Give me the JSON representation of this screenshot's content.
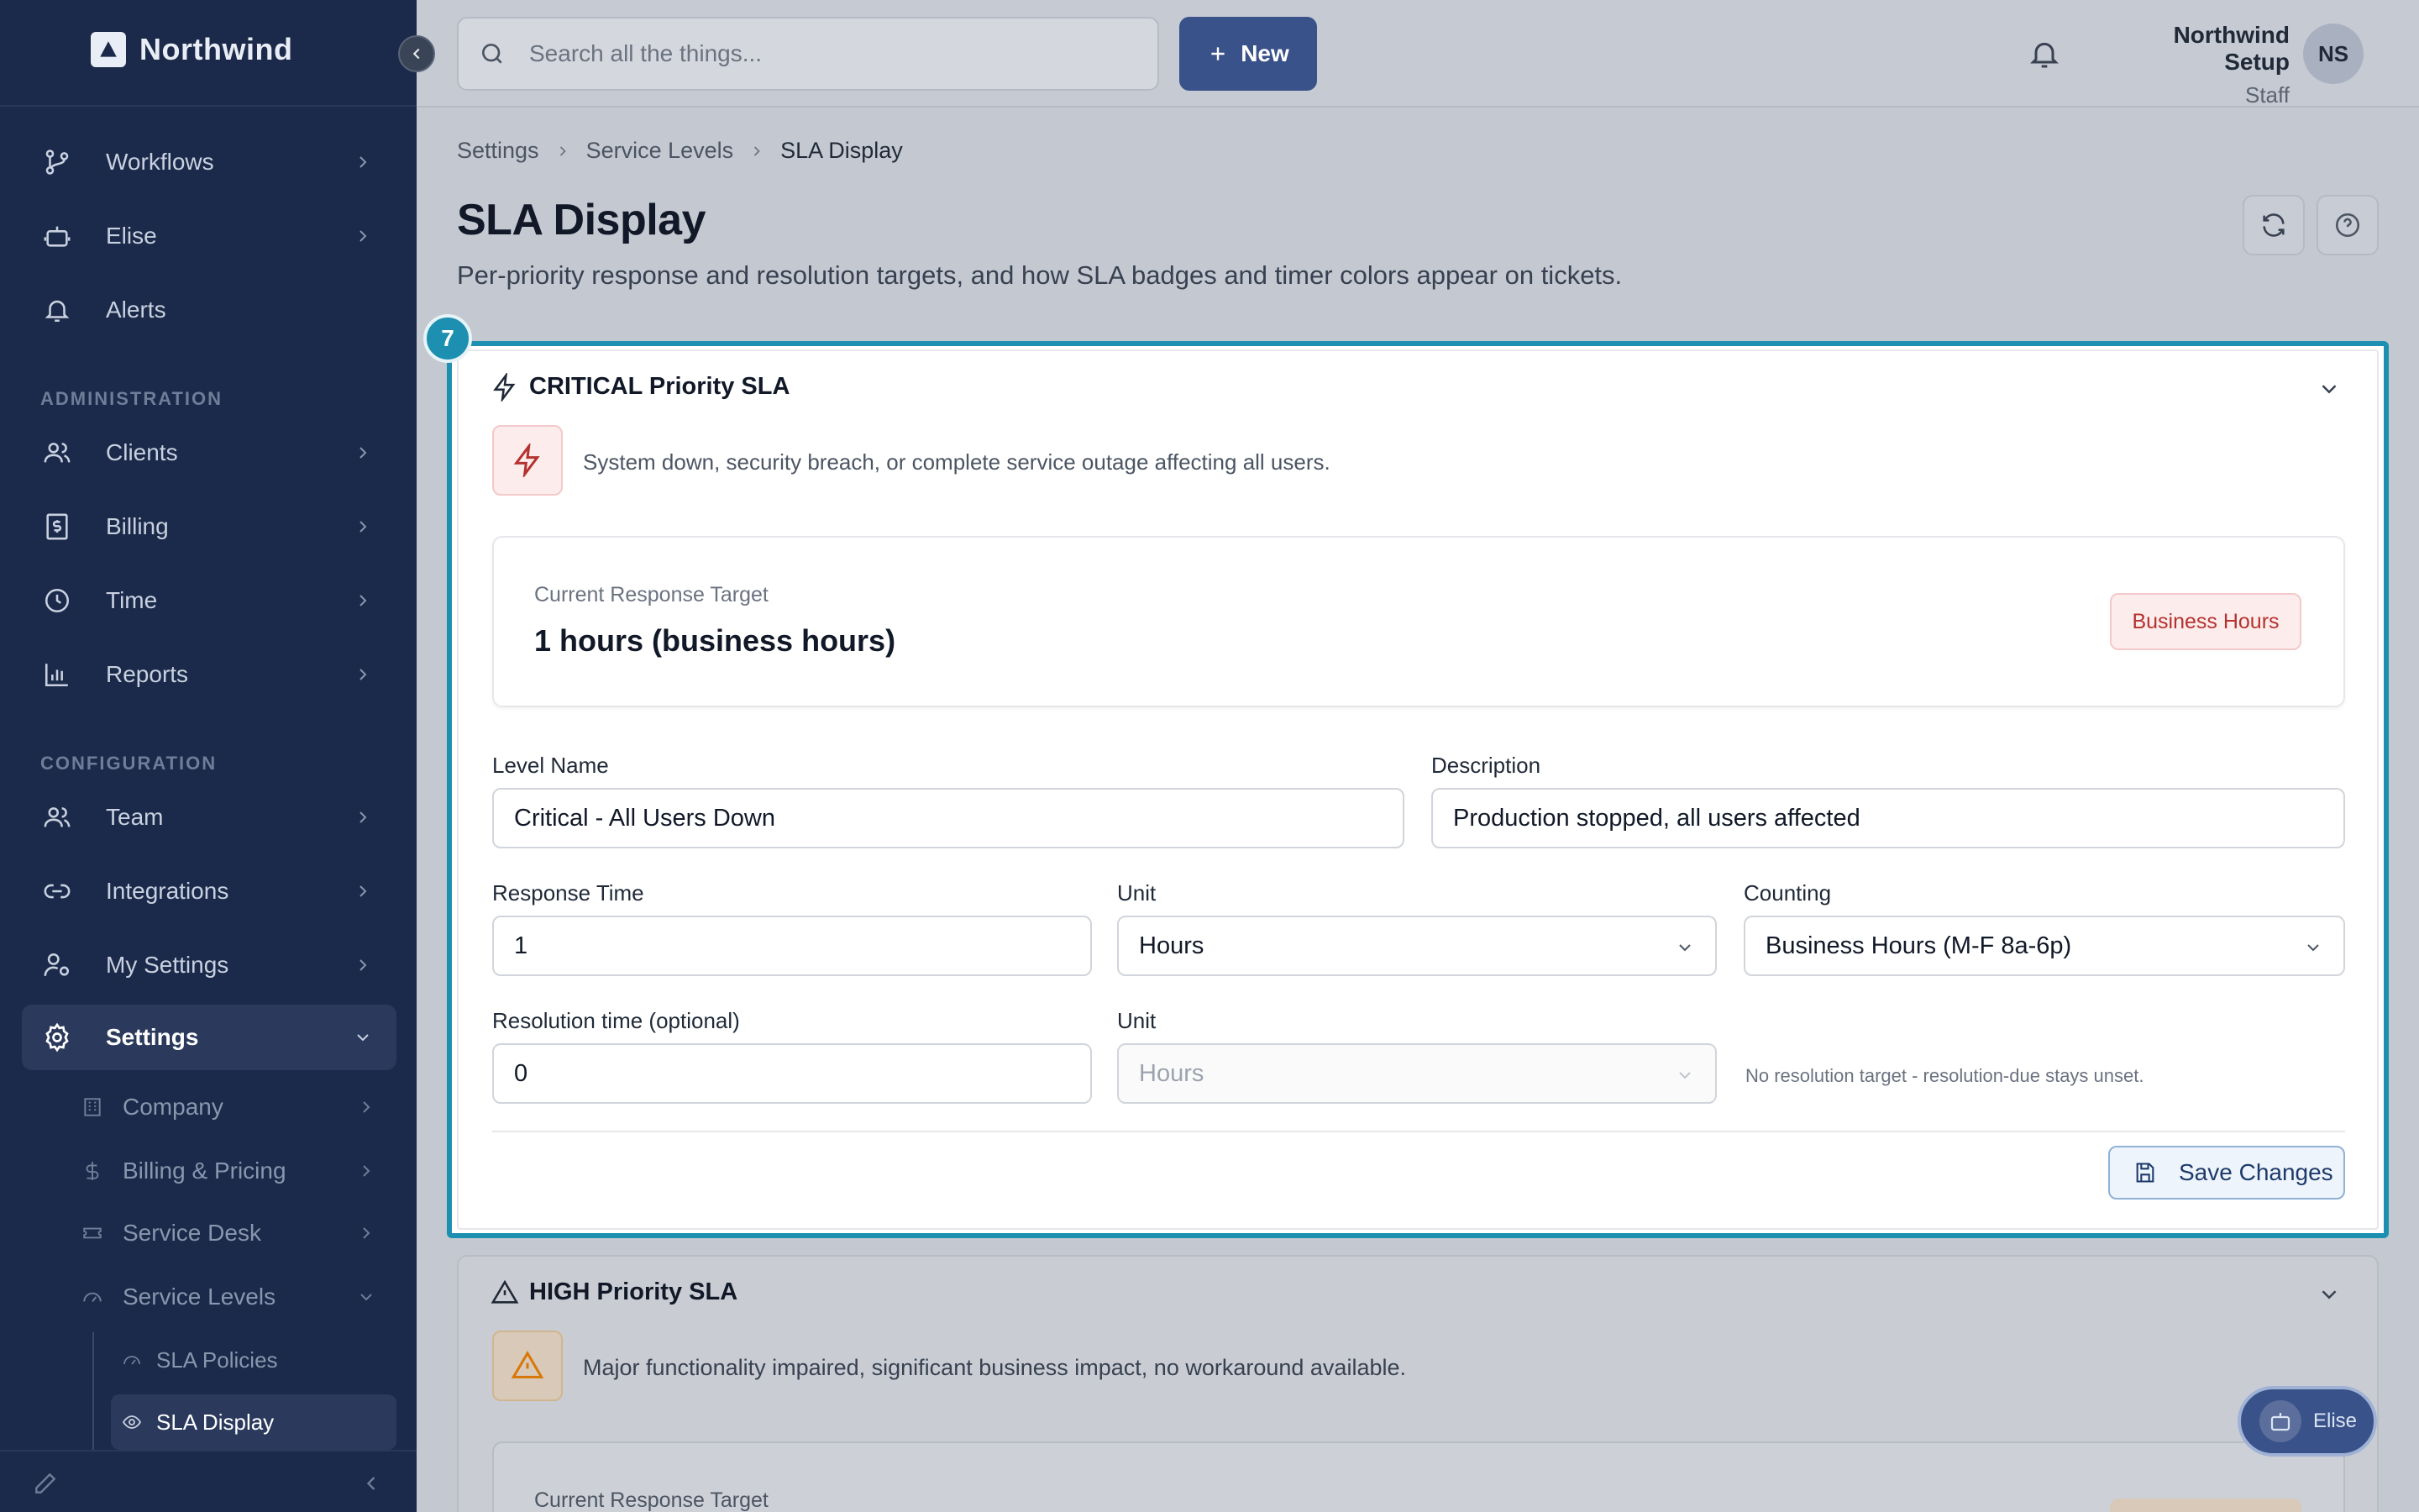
{
  "brand": {
    "name": "Northwind"
  },
  "sidebar": {
    "items": [
      {
        "label": "Workflows"
      },
      {
        "label": "Elise"
      },
      {
        "label": "Alerts"
      }
    ],
    "admin_section": "ADMINISTRATION",
    "admin_items": [
      {
        "label": "Clients"
      },
      {
        "label": "Billing"
      },
      {
        "label": "Time"
      },
      {
        "label": "Reports"
      }
    ],
    "config_section": "CONFIGURATION",
    "config_items": [
      {
        "label": "Team"
      },
      {
        "label": "Integrations"
      },
      {
        "label": "My Settings"
      },
      {
        "label": "Settings"
      }
    ],
    "settings_sub": [
      {
        "label": "Company"
      },
      {
        "label": "Billing & Pricing"
      },
      {
        "label": "Service Desk"
      },
      {
        "label": "Service Levels"
      }
    ],
    "service_levels_sub": [
      {
        "label": "SLA Policies"
      },
      {
        "label": "SLA Display"
      }
    ]
  },
  "topbar": {
    "search_placeholder": "Search all the things...",
    "new_label": "New",
    "user_name": "Northwind Setup",
    "user_role": "Staff",
    "avatar_initials": "NS"
  },
  "breadcrumb": [
    "Settings",
    "Service Levels",
    "SLA Display"
  ],
  "page": {
    "title": "SLA Display",
    "subtitle": "Per-priority response and resolution targets, and how SLA badges and timer colors appear on tickets."
  },
  "step_badge": "7",
  "critical": {
    "title": "CRITICAL Priority SLA",
    "description": "System down, security breach, or complete service outage affecting all users.",
    "target_label": "Current Response Target",
    "target_value": "1 hours (business hours)",
    "badge": "Business Hours",
    "level_name_label": "Level Name",
    "level_name_value": "Critical - All Users Down",
    "description_label": "Description",
    "description_value": "Production stopped, all users affected",
    "response_time_label": "Response Time",
    "response_time_value": "1",
    "unit_label": "Unit",
    "unit_value": "Hours",
    "counting_label": "Counting",
    "counting_value": "Business Hours (M-F 8a-6p)",
    "resolution_label": "Resolution time (optional)",
    "resolution_value": "0",
    "resolution_unit_label": "Unit",
    "resolution_unit_value": "Hours",
    "hint": "No resolution target - resolution-due stays unset.",
    "save_label": "Save Changes"
  },
  "high": {
    "title": "HIGH Priority SLA",
    "description": "Major functionality impaired, significant business impact, no workaround available.",
    "target_label": "Current Response Target"
  },
  "assistant": {
    "label": "Elise"
  },
  "colors": {
    "sidebar_bg": "#1b2a4a",
    "accent": "#1d8fb0",
    "primary_button": "#3a528a",
    "critical_red": "#b4322f",
    "high_amber": "#d97706"
  }
}
